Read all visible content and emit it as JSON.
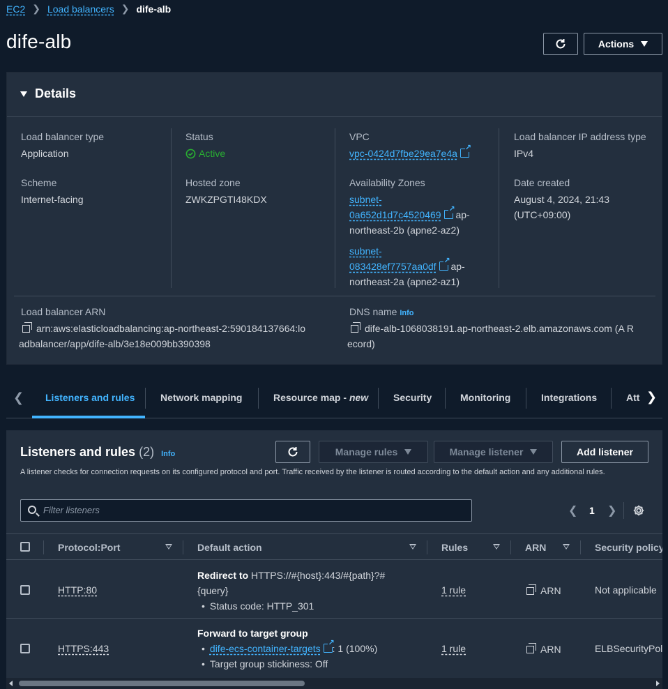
{
  "breadcrumb": {
    "items": [
      "EC2",
      "Load balancers"
    ],
    "current": "dife-alb"
  },
  "page": {
    "title": "dife-alb",
    "refresh_icon": "refresh-icon",
    "actions_label": "Actions"
  },
  "details": {
    "title": "Details",
    "lb_type_label": "Load balancer type",
    "lb_type_value": "Application",
    "status_label": "Status",
    "status_value": "Active",
    "vpc_label": "VPC",
    "vpc_value": "vpc-0424d7fbe29ea7e4a",
    "ip_type_label": "Load balancer IP address type",
    "ip_type_value": "IPv4",
    "scheme_label": "Scheme",
    "scheme_value": "Internet-facing",
    "hosted_zone_label": "Hosted zone",
    "hosted_zone_value": "ZWKZPGTI48KDX",
    "az_label": "Availability Zones",
    "az": [
      {
        "subnet_line1": "subnet-",
        "subnet_line2": "0a652d1d7c4520469",
        "suffix1": "ap-",
        "suffix2": "northeast-2b (apne2-az2)"
      },
      {
        "subnet_line1": "subnet-",
        "subnet_line2": "083428ef7757aa0df",
        "suffix1": "ap-",
        "suffix2": "northeast-2a (apne2-az1)"
      }
    ],
    "date_label": "Date created",
    "date_line1": "August 4, 2024, 21:43",
    "date_line2": "(UTC+09:00)",
    "arn_label": "Load balancer ARN",
    "arn_line1": "arn:aws:elasticloadbalancing:ap-northeast-2:590184137664:lo",
    "arn_line2": "adbalancer/app/dife-alb/3e18e009bb390398",
    "dns_label": "DNS name",
    "dns_info": "Info",
    "dns_line1": "dife-alb-1068038191.ap-northeast-2.elb.amazonaws.com (A R",
    "dns_line2": "ecord)"
  },
  "tabs": {
    "items": [
      "Listeners and rules",
      "Network mapping",
      "Resource map - ",
      "Security",
      "Monitoring",
      "Integrations",
      "Att"
    ],
    "new_label": "new",
    "active": "Listeners and rules"
  },
  "listeners": {
    "title": "Listeners and rules",
    "count": "(2)",
    "info": "Info",
    "manage_rules": "Manage rules",
    "manage_listener": "Manage listener",
    "add_listener": "Add listener",
    "description": "A listener checks for connection requests on its configured protocol and port. Traffic received by the listener is routed according to the default action and any additional rules.",
    "filter_placeholder": "Filter listeners",
    "page": "1",
    "columns": [
      "Protocol:Port",
      "Default action",
      "Rules",
      "ARN",
      "Security policy"
    ],
    "rows": [
      {
        "protocol": "HTTP:80",
        "action_bold": "Redirect to",
        "action_rest": " HTTPS://#{host}:443/#{path}?#",
        "action_line2": "{query}",
        "bullet1": "Status code: HTTP_301",
        "rules": "1 rule",
        "arn": "ARN",
        "policy": "Not applicable"
      },
      {
        "protocol": "HTTPS:443",
        "action_bold": "Forward to target group",
        "target": "dife-ecs-container-targets",
        "target_suffix": ": 1 (100%)",
        "bullet2": "Target group stickiness: Off",
        "rules": "1 rule",
        "arn": "ARN",
        "policy": "ELBSecurityPoli"
      }
    ]
  }
}
